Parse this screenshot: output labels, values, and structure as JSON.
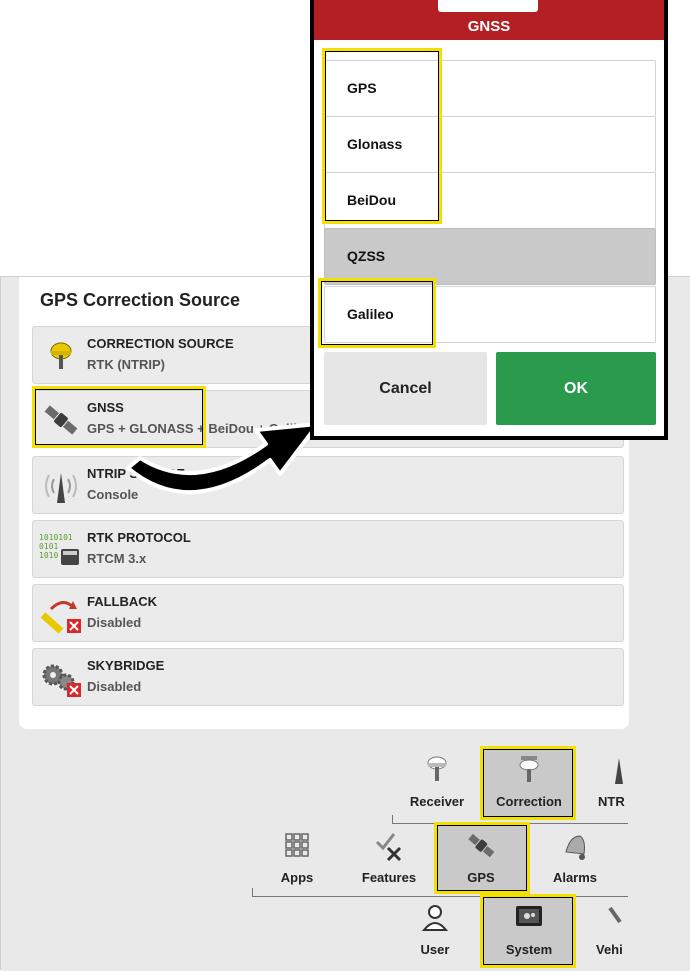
{
  "panel": {
    "title": "GPS Correction Source",
    "rows": [
      {
        "title": "CORRECTION SOURCE",
        "value": "RTK (NTRIP)",
        "icon": "receiver-icon"
      },
      {
        "title": "GNSS",
        "value": "GPS + GLONASS + BeiDou + Galileo",
        "icon": "satellite-icon"
      },
      {
        "title": "NTRIP SOURCE",
        "value": "Console",
        "icon": "antenna-icon"
      },
      {
        "title": "RTK PROTOCOL",
        "value": "RTCM 3.x",
        "icon": "binary-data-icon"
      },
      {
        "title": "FALLBACK",
        "value": "Disabled",
        "icon": "fallback-icon"
      },
      {
        "title": "SKYBRIDGE",
        "value": "Disabled",
        "icon": "gears-icon"
      }
    ]
  },
  "nav": {
    "row1": [
      {
        "label": "Receiver",
        "icon": "receiver-icon"
      },
      {
        "label": "Correction",
        "icon": "correction-icon"
      },
      {
        "label": "NTR",
        "icon": "ntrip-icon"
      }
    ],
    "row2": [
      {
        "label": "Apps",
        "icon": "grid-icon"
      },
      {
        "label": "Features",
        "icon": "features-icon"
      },
      {
        "label": "GPS",
        "icon": "satellite-icon"
      },
      {
        "label": "Alarms",
        "icon": "bell-icon"
      }
    ],
    "row3": [
      {
        "label": "User",
        "icon": "user-icon"
      },
      {
        "label": "System",
        "icon": "system-icon"
      },
      {
        "label": "Vehi",
        "icon": "vehicle-icon"
      }
    ]
  },
  "dialog": {
    "title": "GNSS",
    "options": [
      "GPS",
      "Glonass",
      "BeiDou",
      "QZSS",
      "Galileo"
    ],
    "cancel_label": "Cancel",
    "ok_label": "OK"
  },
  "colors": {
    "header_red": "#b41f24",
    "ok_green": "#2a9a4d",
    "highlight_yellow": "#f2e000",
    "selected_grey": "#c9c9c9"
  }
}
